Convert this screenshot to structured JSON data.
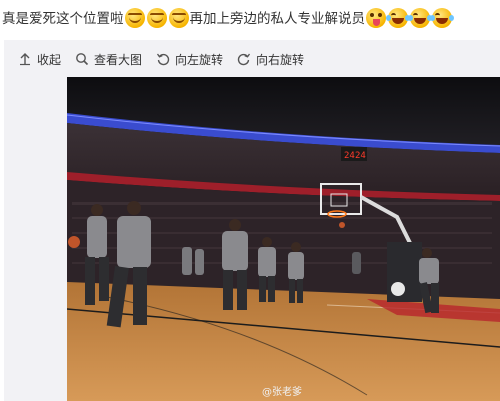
{
  "post": {
    "text_part1": "真是爱死这个位置啦",
    "text_part2": "再加上旁边的私人专业解说员"
  },
  "toolbar": {
    "collapse_label": "收起",
    "view_large_label": "查看大图",
    "rotate_left_label": "向左旋转",
    "rotate_right_label": "向右旋转"
  },
  "photo": {
    "scoreboard_left": "24",
    "scoreboard_right": "24",
    "watermark": "@张老爹"
  },
  "colors": {
    "floor": "#c98a4a",
    "ribbon_blue": "#3a4ccf",
    "court_red": "#b8242c"
  }
}
